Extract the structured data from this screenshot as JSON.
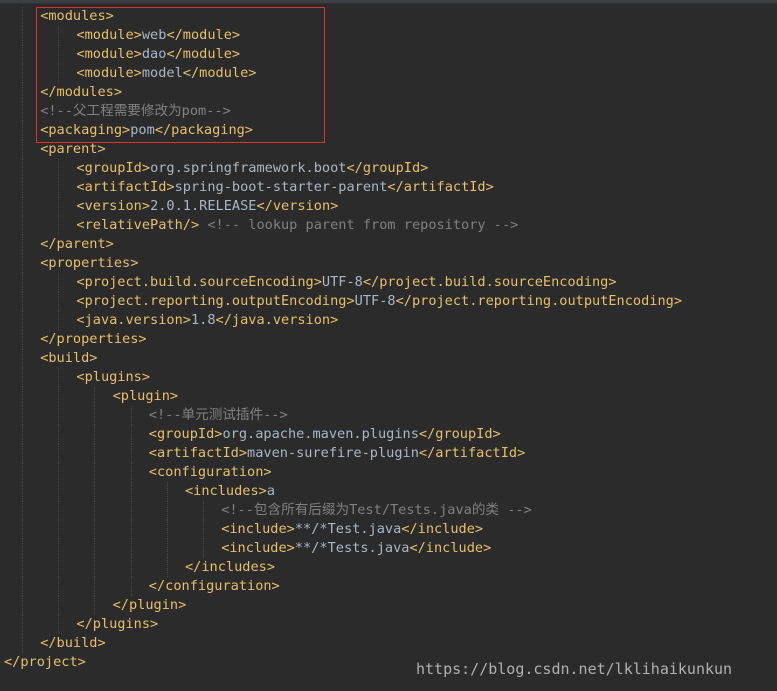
{
  "editor": {
    "lines": [
      {
        "indent": 1,
        "parts": [
          {
            "t": "tag",
            "v": "<modules>"
          }
        ]
      },
      {
        "indent": 2,
        "parts": [
          {
            "t": "tag",
            "v": "<module>"
          },
          {
            "t": "text",
            "v": "web"
          },
          {
            "t": "tag",
            "v": "</module>"
          }
        ]
      },
      {
        "indent": 2,
        "parts": [
          {
            "t": "tag",
            "v": "<module>"
          },
          {
            "t": "text",
            "v": "dao"
          },
          {
            "t": "tag",
            "v": "</module>"
          }
        ]
      },
      {
        "indent": 2,
        "parts": [
          {
            "t": "tag",
            "v": "<module>"
          },
          {
            "t": "text",
            "v": "model"
          },
          {
            "t": "tag",
            "v": "</module>"
          }
        ]
      },
      {
        "indent": 1,
        "parts": [
          {
            "t": "tag",
            "v": "</modules>"
          }
        ]
      },
      {
        "indent": 1,
        "parts": [
          {
            "t": "comment",
            "v": "<!--父工程需要修改为pom-->"
          }
        ]
      },
      {
        "indent": 1,
        "parts": [
          {
            "t": "tag",
            "v": "<packaging>"
          },
          {
            "t": "text",
            "v": "pom"
          },
          {
            "t": "tag",
            "v": "</packaging>"
          }
        ]
      },
      {
        "indent": 1,
        "parts": [
          {
            "t": "tag",
            "v": "<parent>"
          }
        ]
      },
      {
        "indent": 2,
        "parts": [
          {
            "t": "tag",
            "v": "<groupId>"
          },
          {
            "t": "text",
            "v": "org.springframework.boot"
          },
          {
            "t": "tag",
            "v": "</groupId>"
          }
        ]
      },
      {
        "indent": 2,
        "parts": [
          {
            "t": "tag",
            "v": "<artifactId>"
          },
          {
            "t": "text",
            "v": "spring-boot-starter-parent"
          },
          {
            "t": "tag",
            "v": "</artifactId>"
          }
        ]
      },
      {
        "indent": 2,
        "parts": [
          {
            "t": "tag",
            "v": "<version>"
          },
          {
            "t": "text",
            "v": "2.0.1.RELEASE"
          },
          {
            "t": "tag",
            "v": "</version>"
          }
        ]
      },
      {
        "indent": 2,
        "parts": [
          {
            "t": "tag",
            "v": "<relativePath/>"
          },
          {
            "t": "text",
            "v": " "
          },
          {
            "t": "comment",
            "v": "<!-- lookup parent from repository -->"
          }
        ]
      },
      {
        "indent": 1,
        "parts": [
          {
            "t": "tag",
            "v": "</parent>"
          }
        ]
      },
      {
        "indent": 1,
        "parts": [
          {
            "t": "tag",
            "v": "<properties>"
          }
        ]
      },
      {
        "indent": 2,
        "parts": [
          {
            "t": "tag",
            "v": "<project.build.sourceEncoding>"
          },
          {
            "t": "text",
            "v": "UTF-8"
          },
          {
            "t": "tag",
            "v": "</project.build.sourceEncoding>"
          }
        ]
      },
      {
        "indent": 2,
        "parts": [
          {
            "t": "tag",
            "v": "<project.reporting.outputEncoding>"
          },
          {
            "t": "text",
            "v": "UTF-8"
          },
          {
            "t": "tag",
            "v": "</project.reporting.outputEncoding>"
          }
        ]
      },
      {
        "indent": 2,
        "parts": [
          {
            "t": "tag",
            "v": "<java.version>"
          },
          {
            "t": "text",
            "v": "1.8"
          },
          {
            "t": "tag",
            "v": "</java.version>"
          }
        ]
      },
      {
        "indent": 1,
        "parts": [
          {
            "t": "tag",
            "v": "</properties>"
          }
        ]
      },
      {
        "indent": 1,
        "parts": [
          {
            "t": "tag",
            "v": "<build>"
          }
        ]
      },
      {
        "indent": 2,
        "parts": [
          {
            "t": "tag",
            "v": "<plugins>"
          }
        ]
      },
      {
        "indent": 3,
        "parts": [
          {
            "t": "tag",
            "v": "<plugin>"
          }
        ]
      },
      {
        "indent": 4,
        "parts": [
          {
            "t": "comment",
            "v": "<!--单元测试插件-->"
          }
        ]
      },
      {
        "indent": 4,
        "parts": [
          {
            "t": "tag",
            "v": "<groupId>"
          },
          {
            "t": "text",
            "v": "org.apache.maven.plugins"
          },
          {
            "t": "tag",
            "v": "</groupId>"
          }
        ]
      },
      {
        "indent": 4,
        "parts": [
          {
            "t": "tag",
            "v": "<artifactId>"
          },
          {
            "t": "text",
            "v": "maven-surefire-plugin"
          },
          {
            "t": "tag",
            "v": "</artifactId>"
          }
        ]
      },
      {
        "indent": 4,
        "parts": [
          {
            "t": "tag",
            "v": "<configuration>"
          }
        ]
      },
      {
        "indent": 5,
        "parts": [
          {
            "t": "tag",
            "v": "<includes>"
          },
          {
            "t": "text",
            "v": "a"
          }
        ]
      },
      {
        "indent": 6,
        "parts": [
          {
            "t": "comment",
            "v": "<!--包含所有后缀为Test/Tests.java的类 -->"
          }
        ]
      },
      {
        "indent": 6,
        "parts": [
          {
            "t": "tag",
            "v": "<include>"
          },
          {
            "t": "text",
            "v": "**/*Test.java"
          },
          {
            "t": "tag",
            "v": "</include>"
          }
        ]
      },
      {
        "indent": 6,
        "parts": [
          {
            "t": "tag",
            "v": "<include>"
          },
          {
            "t": "text",
            "v": "**/*Tests.java"
          },
          {
            "t": "tag",
            "v": "</include>"
          }
        ]
      },
      {
        "indent": 5,
        "parts": [
          {
            "t": "tag",
            "v": "</includes>"
          }
        ]
      },
      {
        "indent": 4,
        "parts": [
          {
            "t": "tag",
            "v": "</configuration>"
          }
        ]
      },
      {
        "indent": 3,
        "parts": [
          {
            "t": "tag",
            "v": "</plugin>"
          }
        ]
      },
      {
        "indent": 2,
        "parts": [
          {
            "t": "tag",
            "v": "</plugins>"
          }
        ]
      },
      {
        "indent": 1,
        "parts": [
          {
            "t": "tag",
            "v": "</build>"
          }
        ]
      },
      {
        "indent": 0,
        "parts": [
          {
            "t": "tag",
            "v": "</project>"
          }
        ]
      }
    ]
  },
  "watermark": "https://blog.csdn.net/lklihaikunkun",
  "colors": {
    "background": "#2b2b2b",
    "tag": "#e8bf6a",
    "text": "#a9b7c6",
    "comment": "#808080",
    "highlight_border": "#e0332f"
  }
}
